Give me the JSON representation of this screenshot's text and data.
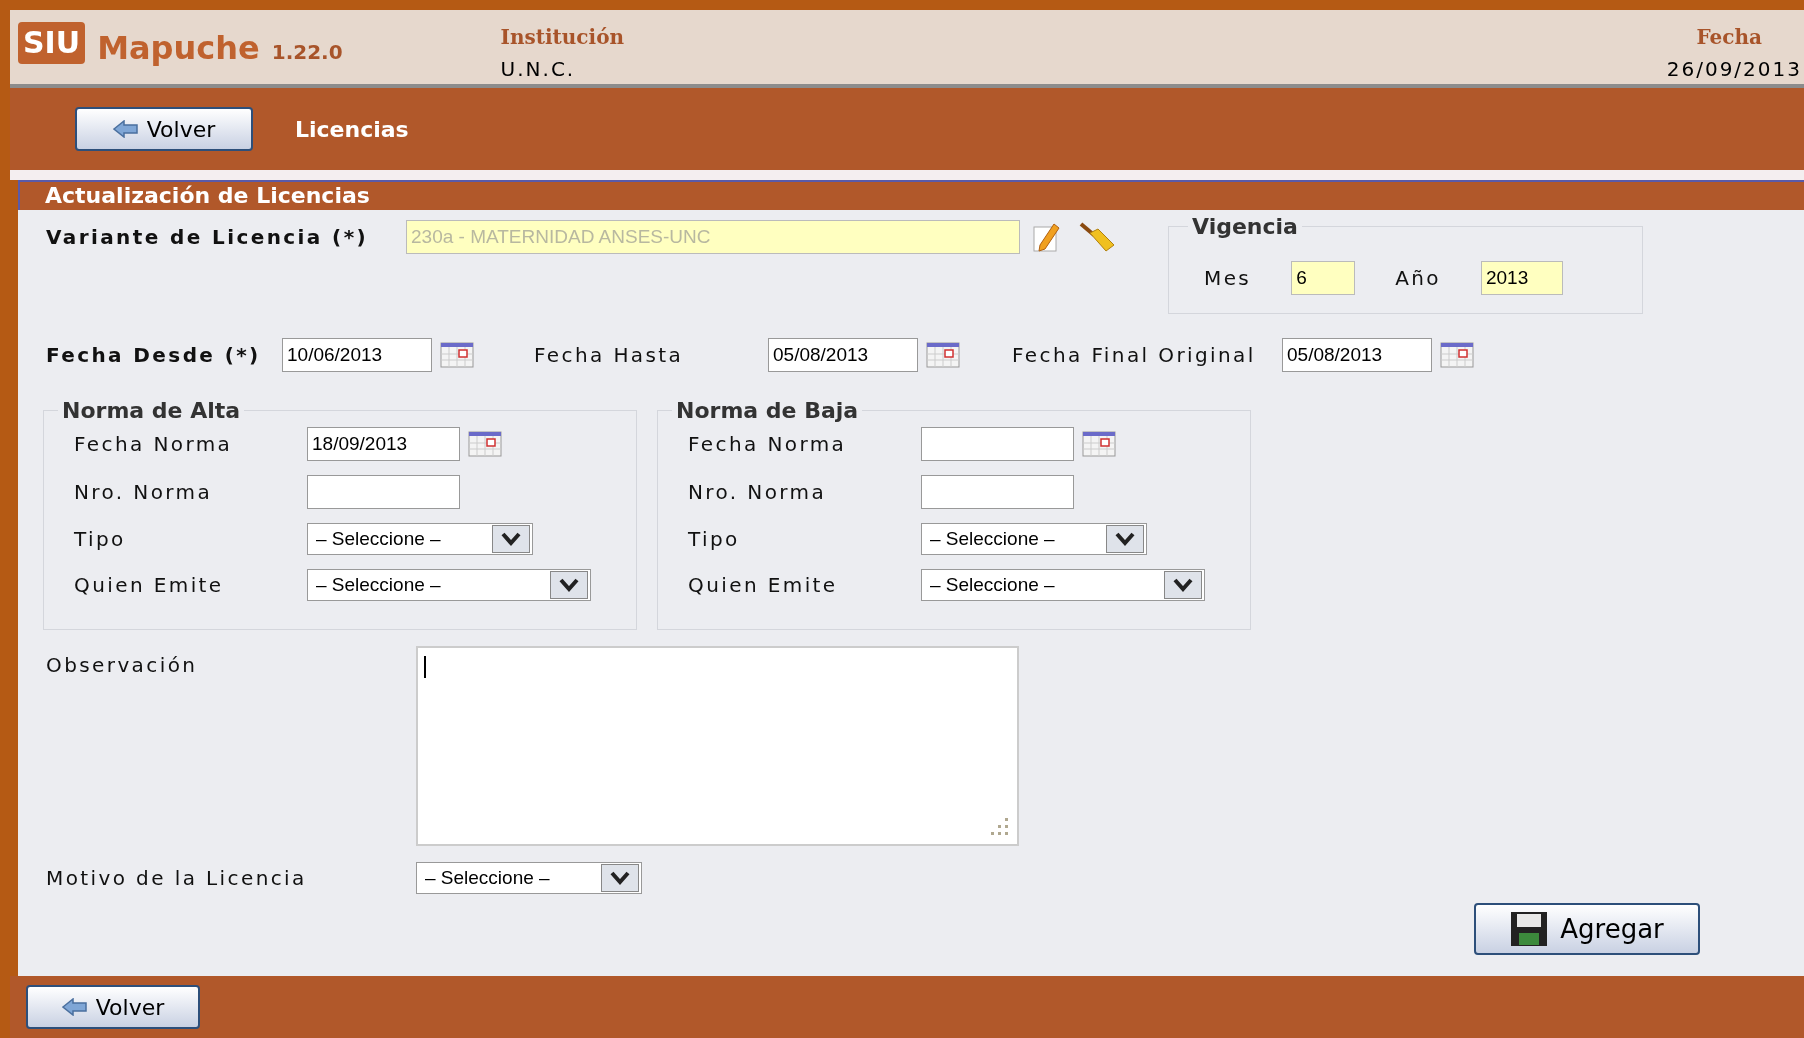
{
  "header": {
    "logo": {
      "brand": "SIU",
      "name": "Mapuche",
      "version": "1.22.0"
    },
    "institution": {
      "label": "Institución",
      "value": "U.N.C."
    },
    "date": {
      "label": "Fecha",
      "value": "26/09/2013"
    }
  },
  "nav": {
    "back_button": "Volver",
    "title": "Licencias"
  },
  "form": {
    "title": "Actualización de Licencias",
    "variante": {
      "label": "Variante de Licencia (*)",
      "value": "230a - MATERNIDAD ANSES-UNC",
      "disabled": true
    },
    "vigencia": {
      "legend": "Vigencia",
      "fields": [
        {
          "label": "Mes",
          "value": "6"
        },
        {
          "label": "Año",
          "value": "2013"
        }
      ]
    },
    "dates": [
      {
        "label": "Fecha Desde (*)",
        "value": "10/06/2013",
        "required": true
      },
      {
        "label": "Fecha Hasta",
        "value": "05/08/2013",
        "required": false
      },
      {
        "label": "Fecha Final Original",
        "value": "05/08/2013",
        "required": false
      }
    ],
    "normas": [
      {
        "legend": "Norma de Alta",
        "fecha": {
          "label": "Fecha Norma",
          "value": "18/09/2013"
        },
        "nro": {
          "label": "Nro. Norma"
        },
        "tipo": {
          "label": "Tipo",
          "value": "– Seleccione –"
        },
        "emite": {
          "label": "Quien Emite",
          "value": "– Seleccione –"
        }
      },
      {
        "legend": "Norma de Baja",
        "fecha": {
          "label": "Fecha Norma"
        },
        "nro": {
          "label": "Nro. Norma"
        },
        "tipo": {
          "label": "Tipo",
          "value": "– Seleccione –"
        },
        "emite": {
          "label": "Quien Emite",
          "value": "– Seleccione –"
        }
      }
    ],
    "observacion": {
      "label": "Observación",
      "focused": true
    },
    "motivo": {
      "label": "Motivo de la Licencia",
      "value": "– Seleccione –"
    },
    "submit": "Agregar"
  },
  "footer": {
    "back_button": "Volver"
  }
}
